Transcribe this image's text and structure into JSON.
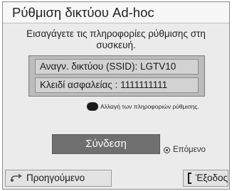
{
  "dialog": {
    "title": "Ρύθμιση δικτύου Ad-hoc",
    "instruction": "Εισαγάγετε τις πληροφορίες ρύθμισης στη συσκευή.",
    "ssid_line": "Αναγν. δικτύου (SSID): LGTV10",
    "key_line": "Κλειδί ασφαλείας : 1111111111",
    "edit_label": "Αλλαγή των πληροφοριών ρύθμισης.",
    "connect_label": "Σύνδεση",
    "next_hint": "Επόμενο"
  },
  "footer": {
    "back_label": "Προηγούμενο",
    "exit_label": "Έξοδος"
  },
  "icons": {
    "edit_key": "black-color-key-icon",
    "next": "ok-button-icon",
    "back": "return-icon",
    "exit": "exit-icon"
  }
}
